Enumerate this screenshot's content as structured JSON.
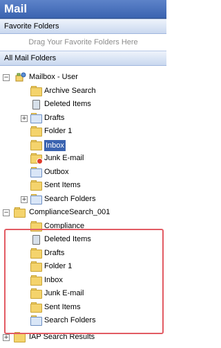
{
  "header": {
    "title": "Mail"
  },
  "favorites": {
    "title": "Favorite Folders",
    "hint": "Drag Your Favorite Folders Here"
  },
  "all_folders": {
    "title": "All Mail Folders"
  },
  "tree": {
    "mailbox_user": "Mailbox - User",
    "archive_search": "Archive Search",
    "deleted_items": "Deleted Items",
    "drafts": "Drafts",
    "folder1": "Folder 1",
    "inbox": "Inbox",
    "junk": "Junk E-mail",
    "outbox": "Outbox",
    "sent": "Sent Items",
    "search_folders": "Search Folders",
    "compliance_root": "ComplianceSearch_001",
    "c_compliance": "Compliance",
    "c_deleted": "Deleted Items",
    "c_drafts": "Drafts",
    "c_folder1": "Folder 1",
    "c_inbox": "Inbox",
    "c_junk": "Junk E-mail",
    "c_sent": "Sent Items",
    "c_search": "Search Folders",
    "iap": "IAP Search Results"
  },
  "colors": {
    "header": "#3a63b0",
    "selection": "#3a63b0",
    "highlight_box": "#e25b63"
  }
}
